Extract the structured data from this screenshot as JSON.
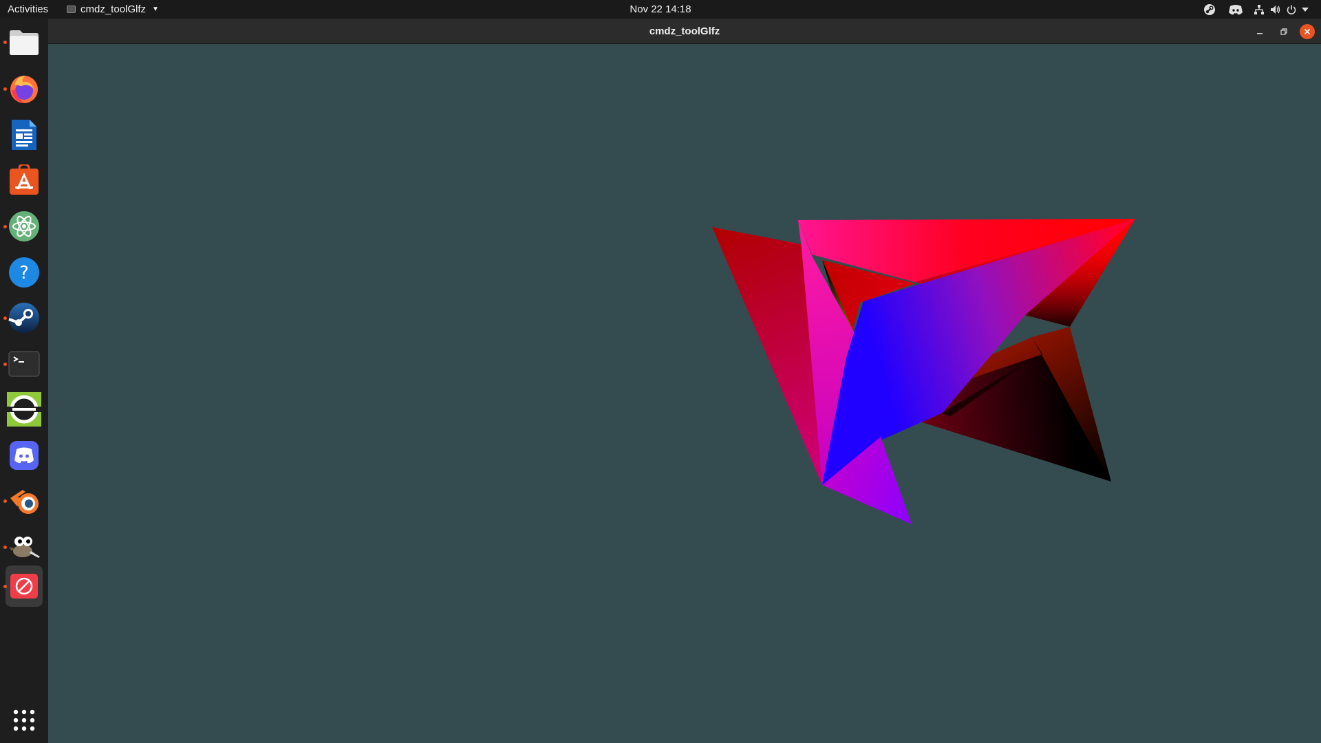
{
  "topbar": {
    "activities_label": "Activities",
    "app_menu_label": "cmdz_toolGlfz",
    "datetime": "Nov 22  14:18",
    "tray_icons": [
      "steam-tray-icon",
      "discord-tray-icon",
      "network-icon",
      "volume-icon",
      "power-icon",
      "chevron-down-icon"
    ]
  },
  "dock": {
    "items": [
      {
        "name": "files",
        "icon": "files-icon",
        "running": true
      },
      {
        "name": "firefox",
        "icon": "firefox-icon",
        "running": true
      },
      {
        "name": "libreoffice-writer",
        "icon": "writer-icon",
        "running": false
      },
      {
        "name": "ubuntu-software",
        "icon": "software-icon",
        "running": false
      },
      {
        "name": "atom",
        "icon": "atom-icon",
        "running": true
      },
      {
        "name": "help",
        "icon": "help-icon",
        "running": false
      },
      {
        "name": "steam",
        "icon": "steam-icon",
        "running": true
      },
      {
        "name": "terminal",
        "icon": "terminal-icon",
        "running": true
      },
      {
        "name": "app-green",
        "icon": "green-ring-icon",
        "running": false
      },
      {
        "name": "discord",
        "icon": "discord-icon",
        "running": false
      },
      {
        "name": "blender",
        "icon": "blender-icon",
        "running": true
      },
      {
        "name": "gimp",
        "icon": "gimp-icon",
        "running": true
      },
      {
        "name": "cmdz-toolglfz",
        "icon": "no-entry-icon",
        "running": true,
        "active": true
      }
    ],
    "show_apps_icon": "apps-grid-icon"
  },
  "window": {
    "title": "cmdz_toolGlfz",
    "controls": [
      "minimize-icon",
      "restore-icon",
      "close-icon"
    ],
    "background_color": "#344c4f",
    "scene": "3d-star-polyhedron"
  },
  "colors": {
    "accent": "#e95420",
    "topbar_bg": "#1a1a1a",
    "dock_bg": "#1e1e1e",
    "close_button": "#e95420"
  }
}
